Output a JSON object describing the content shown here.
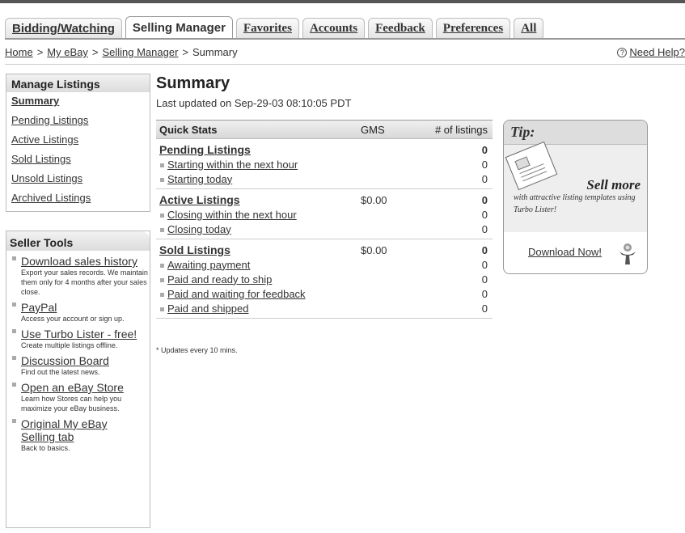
{
  "tabs": [
    {
      "label": "Bidding/Watching",
      "active": false
    },
    {
      "label": "Selling Manager",
      "active": true
    },
    {
      "label": "Favorites",
      "active": false
    },
    {
      "label": "Accounts",
      "active": false
    },
    {
      "label": "Feedback",
      "active": false
    },
    {
      "label": "Preferences",
      "active": false
    },
    {
      "label": "All",
      "active": false
    }
  ],
  "breadcrumb": {
    "home": "Home",
    "sep1": ">",
    "myebay": "My eBay",
    "sep2": ">",
    "selling_manager": "Selling Manager",
    "sep3": ">",
    "current": "Summary"
  },
  "help": {
    "icon": "?",
    "label": "Need Help?"
  },
  "manage_listings": {
    "title": "Manage Listings",
    "items": [
      "Summary",
      "Pending Listings",
      "Active Listings",
      "Sold Listings",
      "Unsold Listings",
      "Archived Listings"
    ]
  },
  "seller_tools": {
    "title": "Seller Tools",
    "items": [
      {
        "title": "Download sales history",
        "desc": "Export your sales records. We maintain them only for 4 months after your sales close."
      },
      {
        "title": "PayPal",
        "desc": "Access your account or sign up."
      },
      {
        "title": "Use Turbo Lister - free!",
        "desc": "Create multiple listings offline."
      },
      {
        "title": "Discussion Board",
        "desc": "Find out the latest news."
      },
      {
        "title": "Open an eBay Store",
        "desc": "Learn how Stores can help you maximize your eBay business."
      },
      {
        "title": "Original My eBay Selling tab",
        "desc": "Back to basics."
      }
    ]
  },
  "main": {
    "title": "Summary",
    "updated": "Last updated on Sep-29-03 08:10:05 PDT",
    "note": "* Updates every 10 mins."
  },
  "quick_stats": {
    "headers": {
      "label": "Quick Stats",
      "gms": "GMS",
      "count": "# of listings"
    },
    "pending": {
      "label": "Pending Listings",
      "gms": "",
      "count": "0",
      "rows": [
        {
          "label": "Starting within the next hour",
          "count": "0"
        },
        {
          "label": "Starting today",
          "count": "0"
        }
      ]
    },
    "active": {
      "label": "Active Listings",
      "gms": "$0.00",
      "count": "0",
      "rows": [
        {
          "label": "Closing within the next hour",
          "count": "0"
        },
        {
          "label": "Closing today",
          "count": "0"
        }
      ]
    },
    "sold": {
      "label": "Sold Listings",
      "gms": "$0.00",
      "count": "0",
      "rows": [
        {
          "label": "Awaiting payment",
          "count": "0"
        },
        {
          "label": "Paid and ready to ship",
          "count": "0"
        },
        {
          "label": "Paid and waiting for feedback",
          "count": "0"
        },
        {
          "label": "Paid and shipped",
          "count": "0"
        }
      ]
    }
  },
  "tip": {
    "title": "Tip:",
    "headline": "Sell more",
    "text": "with attractive listing templates using Turbo Lister!",
    "cta": "Download Now!",
    "illustration_icon": "listing-paper-icon",
    "mascot_icon": "turbo-lister-mascot-icon"
  }
}
